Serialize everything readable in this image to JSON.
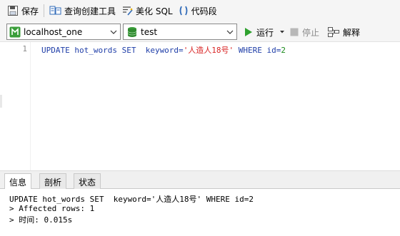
{
  "toolbar": {
    "save": {
      "label": "保存",
      "icon": "save-icon"
    },
    "query_builder": {
      "label": "查询创建工具",
      "icon": "query-builder-icon"
    },
    "beautify": {
      "label": "美化 SQL",
      "icon": "beautify-icon"
    },
    "code_snippet": {
      "label": "代码段",
      "icon": "code-snippet-icon"
    }
  },
  "query_bar": {
    "connection": {
      "value": "localhost_one",
      "icon": "connection-icon"
    },
    "database": {
      "value": "test",
      "icon": "database-icon"
    },
    "run": {
      "label": "运行",
      "icon": "play-icon",
      "color": "#2ea12e"
    },
    "stop": {
      "label": "停止",
      "icon": "stop-icon"
    },
    "explain": {
      "label": "解释",
      "icon": "explain-icon"
    }
  },
  "editor": {
    "line_number": "1",
    "sql": {
      "part1": "UPDATE hot_words SET  keyword=",
      "string": "'人造人18号'",
      "part2": " WHERE id=",
      "number": "2"
    }
  },
  "result_tabs": [
    {
      "label": "信息"
    },
    {
      "label": "剖析"
    },
    {
      "label": "状态"
    }
  ],
  "output": {
    "line1": "UPDATE hot_words SET  keyword='人造人18号' WHERE id=2",
    "line2": "> Affected rows: 1",
    "line3": "> 时间: 0.015s"
  },
  "colors": {
    "keyword": "#1f3ea8",
    "string": "#d92525",
    "number": "#1a8a1a"
  }
}
